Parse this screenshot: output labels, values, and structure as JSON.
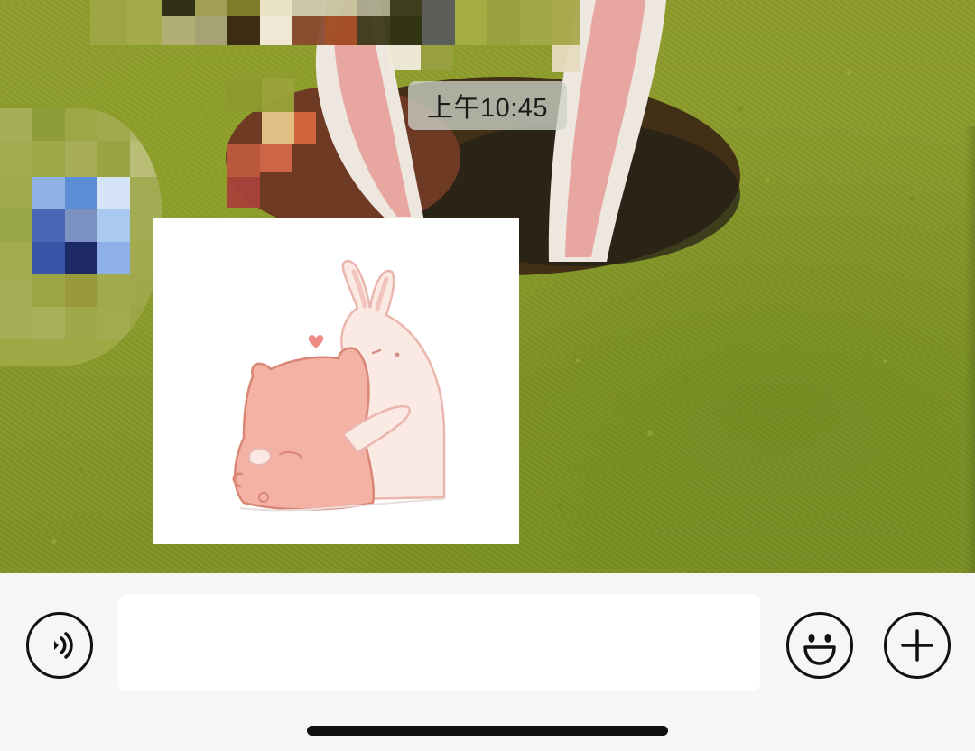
{
  "chat": {
    "timestamp": "上午10:45",
    "messages": [
      {
        "type": "sticker",
        "sticker_name": "pig-and-bunny-hug"
      }
    ],
    "background": "bunny-ears-in-grass-hole"
  },
  "input_bar": {
    "text_value": "",
    "placeholder": "",
    "icons": {
      "voice": "voice-icon",
      "emoji": "emoji-icon",
      "more": "plus-icon"
    }
  },
  "colors": {
    "grass": "#8e9d2c",
    "bar_background": "#f6f6f6",
    "input_background": "#ffffff",
    "icon_stroke": "#111111",
    "timestamp_bg": "#cfd2c8"
  }
}
